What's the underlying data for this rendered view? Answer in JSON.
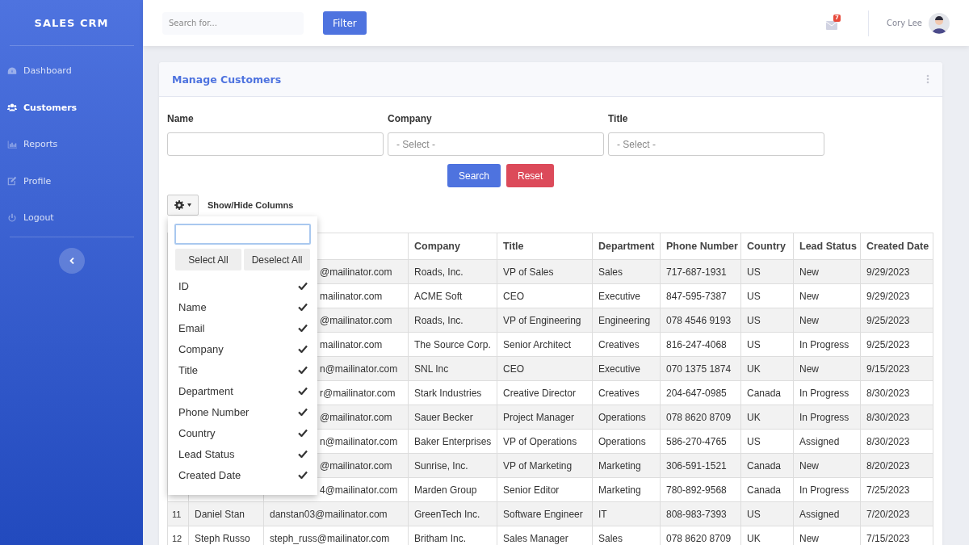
{
  "sidebar": {
    "brand": "SALES CRM",
    "items": [
      {
        "label": "Dashboard",
        "selected": false
      },
      {
        "label": "Customers",
        "selected": true
      },
      {
        "label": "Reports",
        "selected": false
      },
      {
        "label": "Profile",
        "selected": false
      },
      {
        "label": "Logout",
        "selected": false
      }
    ]
  },
  "topbar": {
    "search": {
      "placeholder": "Search for..."
    },
    "filter_button": "Filter",
    "notifications": "7",
    "user": "Cory Lee"
  },
  "card": {
    "title": "Manage Customers",
    "filters": [
      {
        "label": "Name",
        "kind": "text"
      },
      {
        "label": "Company",
        "kind": "select",
        "placeholder": "- Select -"
      },
      {
        "label": "Title",
        "kind": "select",
        "placeholder": "- Select -"
      }
    ],
    "buttons": [
      {
        "label": "Search",
        "kind": "primary"
      },
      {
        "label": "Reset",
        "kind": "danger"
      }
    ],
    "column_toggle": "Show/Hide Columns",
    "column_menu": {
      "select_all": "Select All",
      "deselect_all": "Deselect All",
      "items": [
        {
          "label": "ID",
          "checked": true
        },
        {
          "label": "Name",
          "checked": true
        },
        {
          "label": "Email",
          "checked": true
        },
        {
          "label": "Company",
          "checked": true
        },
        {
          "label": "Title",
          "checked": true
        },
        {
          "label": "Department",
          "checked": true
        },
        {
          "label": "Phone Number",
          "checked": true
        },
        {
          "label": "Country",
          "checked": true
        },
        {
          "label": "Lead Status",
          "checked": true
        },
        {
          "label": "Created Date",
          "checked": true
        }
      ]
    },
    "table": {
      "columns": [
        "Company",
        "Title",
        "Department",
        "Phone Number",
        "Country",
        "Lead Status",
        "Created Date"
      ],
      "rows": [
        {
          "email": "@mailinator.com",
          "company": "Roads, Inc.",
          "title": "VP of Sales",
          "department": "Sales",
          "phone": "717-687-1931",
          "country": "US",
          "status": "New",
          "created": "9/29/2023"
        },
        {
          "email": "mailinator.com",
          "company": "ACME Soft",
          "title": "CEO",
          "department": "Executive",
          "phone": "847-595-7387",
          "country": "US",
          "status": "New",
          "created": "9/29/2023"
        },
        {
          "email": "@mailinator.com",
          "company": "Roads, Inc.",
          "title": "VP of Engineering",
          "department": "Engineering",
          "phone": "078 4546 9193",
          "country": "US",
          "status": "New",
          "created": "9/25/2023"
        },
        {
          "email": "mailinator.com",
          "company": "The Source Corp.",
          "title": "Senior Architect",
          "department": "Creatives",
          "phone": "816-247-4068",
          "country": "US",
          "status": "In Progress",
          "created": "9/25/2023"
        },
        {
          "email": "n@mailinator.com",
          "company": "SNL Inc",
          "title": "CEO",
          "department": "Executive",
          "phone": "070 1375 1874",
          "country": "UK",
          "status": "New",
          "created": "9/15/2023"
        },
        {
          "email": "r@mailinator.com",
          "company": "Stark Industries",
          "title": "Creative Director",
          "department": "Creatives",
          "phone": "204-647-0985",
          "country": "Canada",
          "status": "In Progress",
          "created": "8/30/2023"
        },
        {
          "email": "@mailinator.com",
          "company": "Sauer Becker",
          "title": "Project Manager",
          "department": "Operations",
          "phone": "078 8620 8709",
          "country": "UK",
          "status": "In Progress",
          "created": "8/30/2023"
        },
        {
          "email": "n@mailinator.com",
          "company": "Baker Enterprises",
          "title": "VP of Operations",
          "department": "Operations",
          "phone": "586-270-4765",
          "country": "US",
          "status": "Assigned",
          "created": "8/30/2023"
        },
        {
          "email": "@mailinator.com",
          "company": "Sunrise, Inc.",
          "title": "VP of Marketing",
          "department": "Marketing",
          "phone": "306-591-1521",
          "country": "Canada",
          "status": "New",
          "created": "8/20/2023"
        },
        {
          "email": "4@mailinator.com",
          "company": "Marden Group",
          "title": "Senior Editor",
          "department": "Marketing",
          "phone": "780-892-9568",
          "country": "Canada",
          "status": "In Progress",
          "created": "7/25/2023"
        },
        {
          "id": "11",
          "name": "Daniel Stan",
          "email": "danstan03@mailinator.com",
          "company": "GreenTech Inc.",
          "title": "Software Engineer",
          "department": "IT",
          "phone": "808-983-7393",
          "country": "US",
          "status": "Assigned",
          "created": "7/20/2023"
        },
        {
          "id": "12",
          "name": "Steph Russo",
          "email": "steph_russ@mailinator.com",
          "company": "Britham Inc.",
          "title": "Sales Manager",
          "department": "Sales",
          "phone": "078 8620 8709",
          "country": "UK",
          "status": "New",
          "created": "7/15/2023"
        }
      ]
    }
  }
}
